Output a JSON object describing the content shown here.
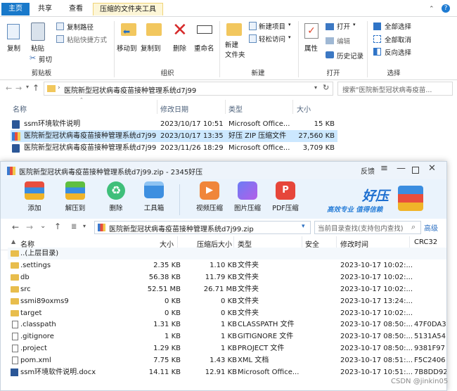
{
  "explorer": {
    "tabs": [
      "主页",
      "共享",
      "查看",
      "压缩的文件夹工具"
    ],
    "ribbon": {
      "copy": "复制",
      "paste": "粘贴",
      "copy_path": "复制路径",
      "paste_shortcut": "粘贴快捷方式",
      "cut": "剪切",
      "clipboard_group": "剪贴板",
      "move_to": "移动到",
      "copy_to": "复制到",
      "delete": "删除",
      "rename": "重命名",
      "organize_group": "组织",
      "new_folder": "新建\n文件夹",
      "new_item": "新建项目",
      "easy_access": "轻松访问",
      "new_group": "新建",
      "properties": "属性",
      "open": "打开",
      "edit": "编辑",
      "history": "历史记录",
      "open_group": "打开",
      "select_all": "全部选择",
      "select_none": "全部取消",
      "invert_selection": "反向选择",
      "select_group": "选择"
    },
    "address": "医院新型冠状病毒疫苗接种管理系统d7j99",
    "search_placeholder": "搜索\"医院新型冠状病毒疫苗...",
    "columns": {
      "name": "名称",
      "date": "修改日期",
      "type": "类型",
      "size": "大小"
    },
    "files": [
      {
        "name": "ssm环境软件说明",
        "date": "2023/10/17 10:51",
        "type": "Microsoft Office...",
        "size": "15 KB"
      },
      {
        "name": "医院新型冠状病毒疫苗接种管理系统d7j99",
        "date": "2023/10/17 13:35",
        "type": "好压 ZIP 压缩文件",
        "size": "27,560 KB"
      },
      {
        "name": "医院新型冠状病毒疫苗接种管理系统d7j99",
        "date": "2023/11/26 18:29",
        "type": "Microsoft Office...",
        "size": "3,709 KB"
      }
    ]
  },
  "haozip": {
    "title": "医院新型冠状病毒疫苗接种管理系统d7j99.zip - 2345好压",
    "feedback": "反馈",
    "tools": [
      "添加",
      "解压到",
      "删除",
      "工具箱",
      "视频压缩",
      "图片压缩",
      "PDF压缩"
    ],
    "brand": "好压",
    "slogan": "高效专业  值得信赖",
    "path": "医院新型冠状病毒疫苗接种管理系统d7j99.zip",
    "search_placeholder": "当前目录查找(支持包内查找)",
    "advanced": "高级",
    "view_label": "≣",
    "columns": {
      "name": "名称",
      "size": "大小",
      "packed": "压缩后大小",
      "type": "类型",
      "security": "安全",
      "modified": "修改时间",
      "crc": "CRC32"
    },
    "rows": [
      {
        "name": "..(上层目录)",
        "size": "",
        "packed": "",
        "type": "",
        "modified": "",
        "crc": "",
        "kind": "folder"
      },
      {
        "name": ".settings",
        "size": "2.35 KB",
        "packed": "1.10 KB",
        "type": "文件夹",
        "modified": "2023-10-17 10:02:...",
        "crc": "",
        "kind": "folder"
      },
      {
        "name": "db",
        "size": "56.38 KB",
        "packed": "11.79 KB",
        "type": "文件夹",
        "modified": "2023-10-17 10:02:...",
        "crc": "",
        "kind": "folder"
      },
      {
        "name": "src",
        "size": "52.51 MB",
        "packed": "26.71 MB",
        "type": "文件夹",
        "modified": "2023-10-17 10:02:...",
        "crc": "",
        "kind": "folder"
      },
      {
        "name": "ssmi89oxms9",
        "size": "0 KB",
        "packed": "0 KB",
        "type": "文件夹",
        "modified": "2023-10-17 13:24:...",
        "crc": "",
        "kind": "folder"
      },
      {
        "name": "target",
        "size": "0 KB",
        "packed": "0 KB",
        "type": "文件夹",
        "modified": "2023-10-17 10:02:...",
        "crc": "",
        "kind": "folder"
      },
      {
        "name": ".classpath",
        "size": "1.31 KB",
        "packed": "1 KB",
        "type": "CLASSPATH 文件",
        "modified": "2023-10-17 08:50:...",
        "crc": "47F0DA3",
        "kind": "file"
      },
      {
        "name": ".gitignore",
        "size": "1 KB",
        "packed": "1 KB",
        "type": "GITIGNORE 文件",
        "modified": "2023-10-17 08:50:...",
        "crc": "5131A54",
        "kind": "file"
      },
      {
        "name": ".project",
        "size": "1.29 KB",
        "packed": "1 KB",
        "type": "PROJECT 文件",
        "modified": "2023-10-17 08:50:...",
        "crc": "9381F97",
        "kind": "file"
      },
      {
        "name": "pom.xml",
        "size": "7.75 KB",
        "packed": "1.43 KB",
        "type": "XML 文档",
        "modified": "2023-10-17 08:51:...",
        "crc": "F5C2406",
        "kind": "file"
      },
      {
        "name": "ssm环境软件说明.docx",
        "size": "14.11 KB",
        "packed": "12.91 KB",
        "type": "Microsoft Office...",
        "modified": "2023-10-17 10:51:...",
        "crc": "7B8DD92",
        "kind": "word"
      }
    ]
  },
  "watermark": "CSDN @jinkin05"
}
